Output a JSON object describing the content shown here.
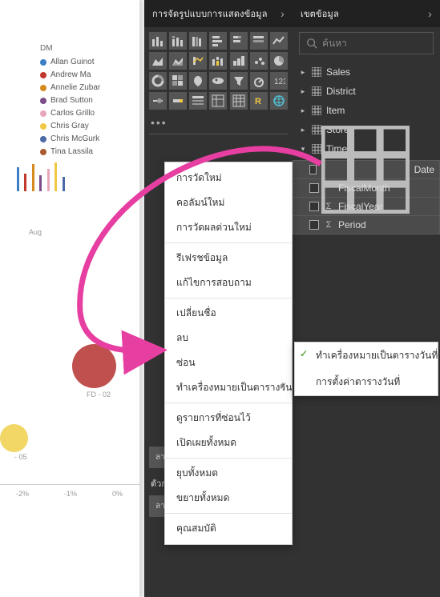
{
  "panels": {
    "visualizations_title": "การจัดรูปแบบการแสดงข้อมูล",
    "fields_title": "เขตข้อมูล",
    "search_placeholder": "ค้นหา"
  },
  "legend": {
    "title": "DM",
    "items": [
      {
        "label": "Allan Guinot",
        "color": "#3b7fc4"
      },
      {
        "label": "Andrew Ma",
        "color": "#c0392b"
      },
      {
        "label": "Annelie Zubar",
        "color": "#d68a1e"
      },
      {
        "label": "Brad Sutton",
        "color": "#7b4c8a"
      },
      {
        "label": "Carlos Grillo",
        "color": "#e8a6bd"
      },
      {
        "label": "Chris Gray",
        "color": "#f2c744"
      },
      {
        "label": "Chris McGurk",
        "color": "#4b6aa8"
      },
      {
        "label": "Tina Lassila",
        "color": "#a95a2f"
      }
    ]
  },
  "canvas": {
    "month_label": "Aug",
    "axis_ticks": [
      "-2%",
      "-1%",
      "0%"
    ],
    "bubble_label_1": "FD - 02",
    "bubble_label_2": "- 05"
  },
  "field_wells": {
    "well1": "ลากเขตข้อมูลการดูรายละเอียดแน...",
    "filters_label": "ตัวกรองระดับรายงาน",
    "well2": "ลากเขตข้อมูลมาที่นี่"
  },
  "tables": [
    {
      "name": "Sales"
    },
    {
      "name": "District"
    },
    {
      "name": "Item"
    },
    {
      "name": "Store"
    },
    {
      "name": "Time",
      "expanded": true
    }
  ],
  "time_fields": [
    {
      "name": "Date",
      "type": "table"
    },
    {
      "name": "FiscalMonth",
      "type": "text"
    },
    {
      "name": "FiscalYear",
      "type": "sum"
    },
    {
      "name": "Period",
      "type": "sum"
    }
  ],
  "context_menu": {
    "section1": [
      "การวัดใหม่",
      "คอลัมน์ใหม่",
      "การวัดผลด่วนใหม่"
    ],
    "section2": [
      "รีเฟรชข้อมูล",
      "แก้ไขการสอบถาม"
    ],
    "section3": [
      "เปลี่ยนชื่อ",
      "ลบ",
      "ซ่อน"
    ],
    "mark_as_date": "ทำเครื่องหมายเป็นตารางวันที่",
    "section4": [
      "ดูรายการที่ซ่อนไว้",
      "เปิดเผยทั้งหมด"
    ],
    "section5": [
      "ยุบทั้งหมด",
      "ขยายทั้งหมด"
    ],
    "section6": [
      "คุณสมบัติ"
    ]
  },
  "submenu": {
    "mark": "ทำเครื่องหมายเป็นตารางวันที่",
    "settings": "การตั้งค่าตารางวันที่"
  }
}
